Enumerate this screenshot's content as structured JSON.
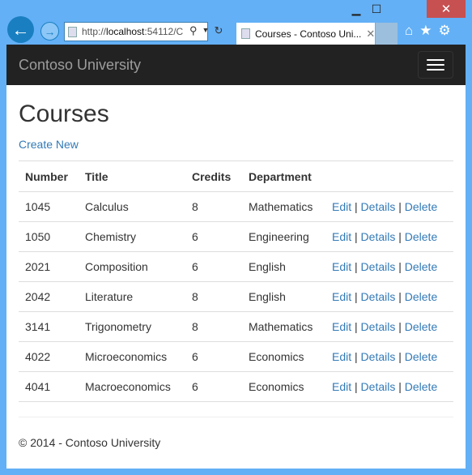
{
  "browser": {
    "url_prefix": "http://",
    "url_host": "localhost",
    "url_rest": ":54112/C",
    "tab_title": "Courses - Contoso Uni...",
    "minimize": "▁",
    "maximize": "☐",
    "close": "✕",
    "icons": [
      "back-icon",
      "forward-icon",
      "search-icon",
      "refresh-icon",
      "home-icon",
      "star-icon",
      "gear-icon"
    ]
  },
  "navbar": {
    "brand": "Contoso University"
  },
  "page": {
    "title": "Courses",
    "create_new": "Create New"
  },
  "table": {
    "headers": [
      "Number",
      "Title",
      "Credits",
      "Department",
      ""
    ],
    "rows": [
      [
        "1045",
        "Calculus",
        "8",
        "Mathematics"
      ],
      [
        "1050",
        "Chemistry",
        "6",
        "Engineering"
      ],
      [
        "2021",
        "Composition",
        "6",
        "English"
      ],
      [
        "2042",
        "Literature",
        "8",
        "English"
      ],
      [
        "3141",
        "Trigonometry",
        "8",
        "Mathematics"
      ],
      [
        "4022",
        "Microeconomics",
        "6",
        "Economics"
      ],
      [
        "4041",
        "Macroeconomics",
        "6",
        "Economics"
      ]
    ],
    "actions": [
      "Edit",
      "Details",
      "Delete"
    ],
    "separator": "|"
  },
  "footer": {
    "text": "© 2014 - Contoso University"
  },
  "colors": {
    "frame": "#63b0f6",
    "navbar": "#222222",
    "link": "#337ab7",
    "close": "#c75050"
  }
}
